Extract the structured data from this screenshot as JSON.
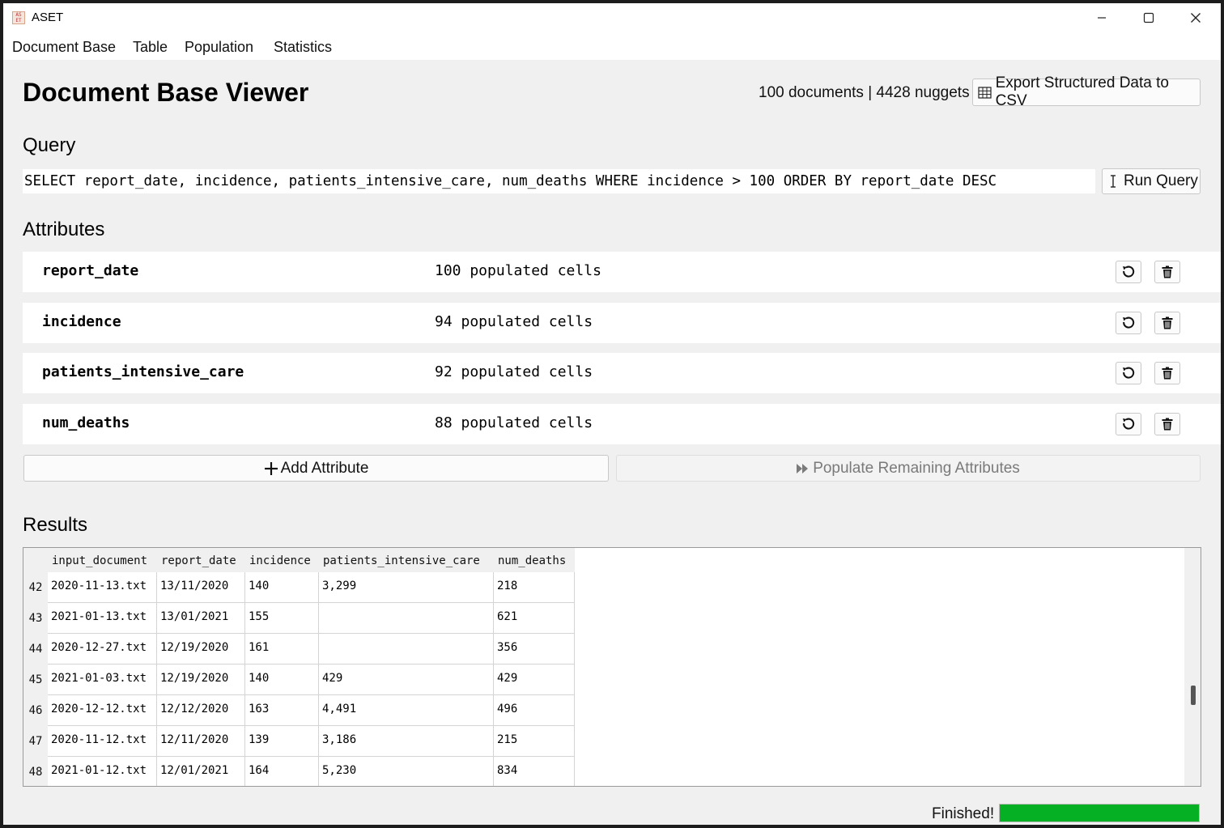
{
  "window": {
    "title": "ASET",
    "icon_label": "A S E T",
    "controls": [
      "minimize-icon",
      "maximize-icon",
      "close-icon"
    ]
  },
  "menu": [
    "Document Base",
    "Table",
    "Population",
    "Statistics"
  ],
  "header": {
    "title": "Document Base Viewer",
    "stats": "100 documents | 4428 nuggets",
    "export_label": "Export Structured Data to CSV",
    "export_icon": "table-icon"
  },
  "query": {
    "heading": "Query",
    "text": "SELECT report_date, incidence, patients_intensive_care, num_deaths WHERE incidence > 100 ORDER BY report_date DESC",
    "run_label": "Run Query",
    "run_icon": "text-cursor-icon"
  },
  "attributes": {
    "heading": "Attributes",
    "items": [
      {
        "name": "report_date",
        "cells": "100 populated cells"
      },
      {
        "name": "incidence",
        "cells": "94 populated cells"
      },
      {
        "name": "patients_intensive_care",
        "cells": "92 populated cells"
      },
      {
        "name": "num_deaths",
        "cells": "88 populated cells"
      }
    ],
    "add_label": "Add Attribute",
    "populate_label": "Populate Remaining Attributes"
  },
  "results": {
    "heading": "Results",
    "columns": [
      "input_document",
      "report_date",
      "incidence",
      "patients_intensive_care",
      "num_deaths"
    ],
    "rows": [
      {
        "index": "42",
        "cells": [
          "2020-11-13.txt",
          "13/11/2020",
          "140",
          "3,299",
          "218"
        ]
      },
      {
        "index": "43",
        "cells": [
          "2021-01-13.txt",
          "13/01/2021",
          "155",
          "",
          "621"
        ]
      },
      {
        "index": "44",
        "cells": [
          "2020-12-27.txt",
          "12/19/2020",
          "161",
          "",
          "356"
        ]
      },
      {
        "index": "45",
        "cells": [
          "2021-01-03.txt",
          "12/19/2020",
          "140",
          "429",
          "429"
        ]
      },
      {
        "index": "46",
        "cells": [
          "2020-12-12.txt",
          "12/12/2020",
          "163",
          "4,491",
          "496"
        ]
      },
      {
        "index": "47",
        "cells": [
          "2020-11-12.txt",
          "12/11/2020",
          "139",
          "3,186",
          "215"
        ]
      },
      {
        "index": "48",
        "cells": [
          "2021-01-12.txt",
          "12/01/2021",
          "164",
          "5,230",
          "834"
        ]
      }
    ]
  },
  "status": {
    "text": "Finished!",
    "progress": 1.0,
    "progress_color": "#06b025"
  }
}
